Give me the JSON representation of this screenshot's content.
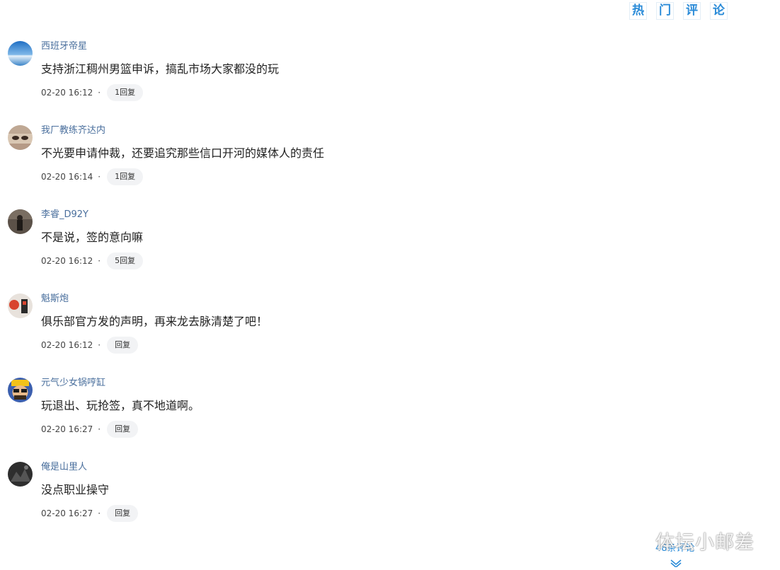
{
  "hot_comments": {
    "chars": [
      "热",
      "门",
      "评",
      "论"
    ]
  },
  "comments": [
    {
      "user": "西班牙帝星",
      "text": "支持浙江稠州男篮申诉，搞乱市场大家都没的玩",
      "time": "02-20 16:12",
      "reply": "1回复",
      "avatar": "sky-avatar"
    },
    {
      "user": "我厂教练齐达内",
      "text": "不光要申请仲裁，还要追究那些信口开河的媒体人的责任",
      "time": "02-20 16:14",
      "reply": "1回复",
      "avatar": "face-avatar"
    },
    {
      "user": "李睿_D92Y",
      "text": "不是说，签的意向嘛",
      "time": "02-20 16:12",
      "reply": "5回复",
      "avatar": "person-avatar"
    },
    {
      "user": "魁斯炮",
      "text": "俱乐部官方发的声明，再来龙去脉清楚了吧！",
      "time": "02-20 16:12",
      "reply": "回复",
      "avatar": "red-avatar"
    },
    {
      "user": "元气少女锅哼缸",
      "text": "玩退出、玩抢签，真不地道啊。",
      "time": "02-20 16:27",
      "reply": "回复",
      "avatar": "cartoon-avatar"
    },
    {
      "user": "俺是山里人",
      "text": "没点职业操守",
      "time": "02-20 16:27",
      "reply": "回复",
      "avatar": "dark-avatar"
    }
  ],
  "separator": "·",
  "more_label": "48条评论",
  "watermark": "体坛小邮差"
}
